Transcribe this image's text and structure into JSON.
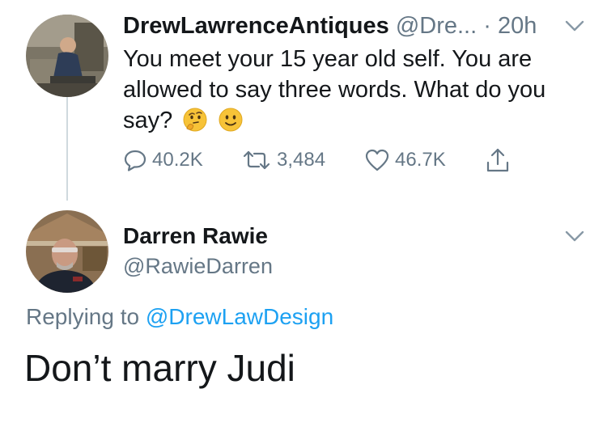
{
  "tweet": {
    "author_name": "DrewLawrenceAntiques",
    "author_handle": "@Dre...",
    "time": "· 20h",
    "text": "You meet your 15 year old self. You are allowed to say three words. What do you say?",
    "emojis": [
      "thinking-face",
      "slightly-smiling-face"
    ],
    "actions": {
      "replies": "40.2K",
      "retweets": "3,484",
      "likes": "46.7K"
    }
  },
  "reply": {
    "author_name": "Darren Rawie",
    "author_handle": "@RawieDarren",
    "replying_prefix": "Replying to",
    "replying_to": "@DrewLawDesign",
    "text": "Don’t marry Judi"
  },
  "colors": {
    "text": "#14171a",
    "muted": "#657786",
    "link": "#1da1f2"
  }
}
